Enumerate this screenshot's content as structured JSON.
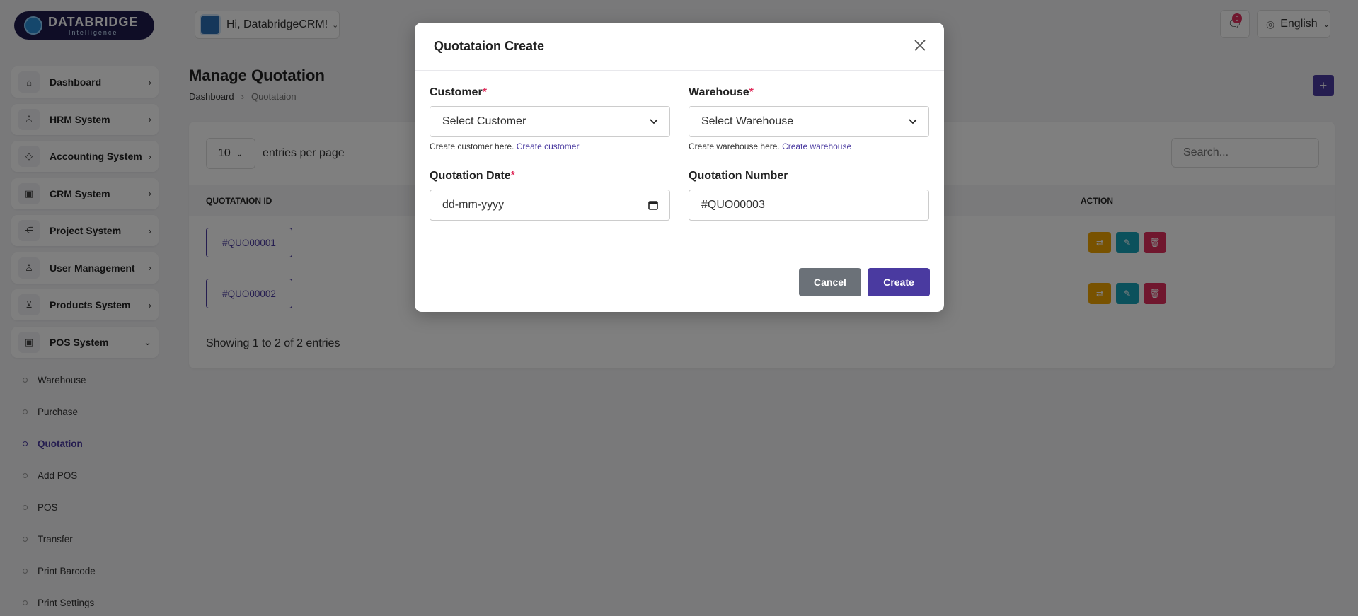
{
  "brand": {
    "name": "DATABRIDGE",
    "tagline": "Intelligence"
  },
  "topbar": {
    "greeting": "Hi, DatabridgeCRM!",
    "notification_count": "0",
    "language": "English"
  },
  "sidebar": {
    "items": [
      {
        "label": "Dashboard",
        "icon": "home-icon"
      },
      {
        "label": "HRM System",
        "icon": "user-icon"
      },
      {
        "label": "Accounting System",
        "icon": "box-icon"
      },
      {
        "label": "CRM System",
        "icon": "layers-icon"
      },
      {
        "label": "Project System",
        "icon": "share-icon"
      },
      {
        "label": "User Management",
        "icon": "users-icon"
      },
      {
        "label": "Products System",
        "icon": "cart-icon"
      },
      {
        "label": "POS System",
        "icon": "layers-icon"
      }
    ],
    "pos_sub_items": [
      {
        "label": "Warehouse"
      },
      {
        "label": "Purchase"
      },
      {
        "label": "Quotation",
        "active": true
      },
      {
        "label": "Add POS"
      },
      {
        "label": "POS"
      },
      {
        "label": "Transfer"
      },
      {
        "label": "Print Barcode"
      },
      {
        "label": "Print Settings"
      }
    ]
  },
  "page": {
    "title": "Manage Quotation",
    "breadcrumb": [
      "Dashboard",
      "Quotataion"
    ],
    "add_button": "+"
  },
  "table": {
    "per_page": "10",
    "per_page_label": "entries per page",
    "search_placeholder": "Search...",
    "columns": [
      "QUOTATAION ID",
      "ACTION"
    ],
    "rows": [
      {
        "id": "#QUO00001"
      },
      {
        "id": "#QUO00002"
      }
    ],
    "showing": "Showing 1 to 2 of 2 entries"
  },
  "modal": {
    "title": "Quotataion Create",
    "customer": {
      "label": "Customer",
      "placeholder": "Select Customer",
      "hint": "Create customer here.",
      "hint_link": "Create customer"
    },
    "warehouse": {
      "label": "Warehouse",
      "placeholder": "Select Warehouse",
      "hint": "Create warehouse here.",
      "hint_link": "Create warehouse"
    },
    "date": {
      "label": "Quotation Date",
      "placeholder": "dd-mm-yyyy"
    },
    "number": {
      "label": "Quotation Number",
      "value": "#QUO00003"
    },
    "required_mark": "*",
    "cancel_label": "Cancel",
    "create_label": "Create"
  },
  "colors": {
    "primary": "#4a3aa0",
    "danger": "#e02e5c",
    "warning": "#f0a500",
    "info": "#17a2b8",
    "secondary": "#6b7178"
  }
}
